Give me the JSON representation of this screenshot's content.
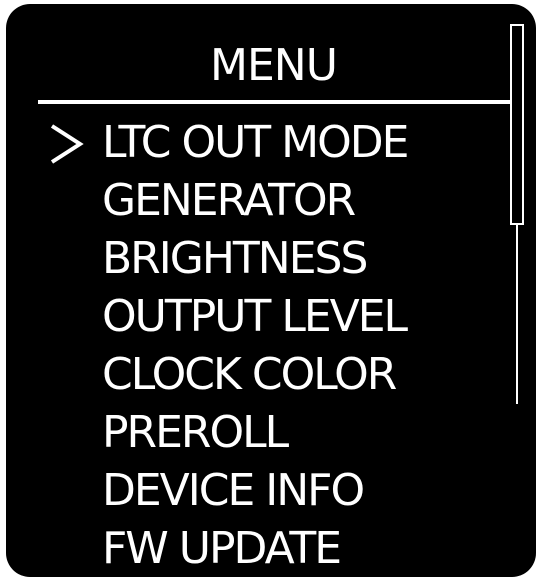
{
  "menu": {
    "title": "MENU",
    "selected_index": 0,
    "items": [
      {
        "label": "LTC OUT MODE"
      },
      {
        "label": "GENERATOR"
      },
      {
        "label": "BRIGHTNESS"
      },
      {
        "label": "OUTPUT LEVEL"
      },
      {
        "label": "CLOCK COLOR"
      },
      {
        "label": "PREROLL"
      },
      {
        "label": "DEVICE INFO"
      },
      {
        "label": "FW UPDATE"
      }
    ]
  },
  "icons": {
    "cursor": "chevron-right-icon"
  },
  "colors": {
    "screen_background": "#000000",
    "text": "#ffffff"
  }
}
